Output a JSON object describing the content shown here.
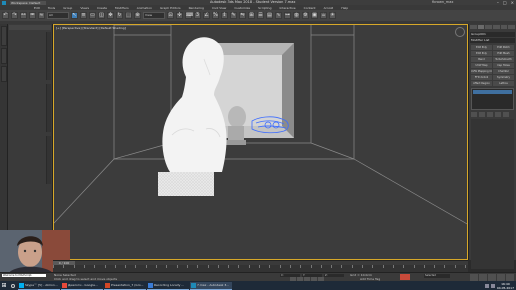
{
  "titlebar": {
    "workspace": "Workspace: Default",
    "title": "Autodesk 3ds Max 2018 - Student Version   7.max",
    "user": "fbrown_max",
    "minimize": "–",
    "maximize": "□",
    "close": "×"
  },
  "menu": [
    "Edit",
    "Tools",
    "Group",
    "Views",
    "Create",
    "Modifiers",
    "Animation",
    "Graph Editors",
    "Rendering",
    "Civil View",
    "Customize",
    "Scripting",
    "Interactive",
    "Content",
    "Arnold",
    "Help"
  ],
  "toolbar": {
    "selection_filter": "All",
    "view_mode": "View"
  },
  "viewport": {
    "label": "[+] [Perspective] [Standard] [Default Shading]"
  },
  "command_panel": {
    "object_name": "Group001",
    "modifier_list": "Modifier List",
    "buttons": [
      "Edit Poly",
      "Edit Patch",
      "Edit Poly",
      "Edit Mesh",
      "Bend",
      "TurboSmooth",
      "UVW Map",
      "Cap Holes",
      "UVW Mapping Clear",
      "Chamfer",
      "FFD 2x2x2",
      "Symmetry",
      "Affect Region",
      "Lattice"
    ]
  },
  "timeline": {
    "slider": "0 / 100"
  },
  "status": {
    "maxscript": "Welcome to MAXScript.",
    "line1": "None Selected",
    "line2": "Click and drag to select and move objects",
    "x": "X:",
    "y": "Y:",
    "z": "Z:",
    "grid": "Grid = 10.0cm",
    "add_time_tag": "Add Time Tag",
    "selected": "Selected"
  },
  "taskbar": {
    "items": [
      "Skype™ [5] - Almon...",
      "Диалоги - Google...",
      "Presentation_7 (Gro...",
      "Recording Locally ...",
      "7.max - Autodesk 3..."
    ],
    "time": "16:40",
    "date": "04.05.2017"
  },
  "colors": {
    "viewport_bg": "#3c3c3c",
    "active_border": "#d7a829",
    "selection_accent": "#3f6f9f",
    "taskbar": "#1e2a38"
  }
}
